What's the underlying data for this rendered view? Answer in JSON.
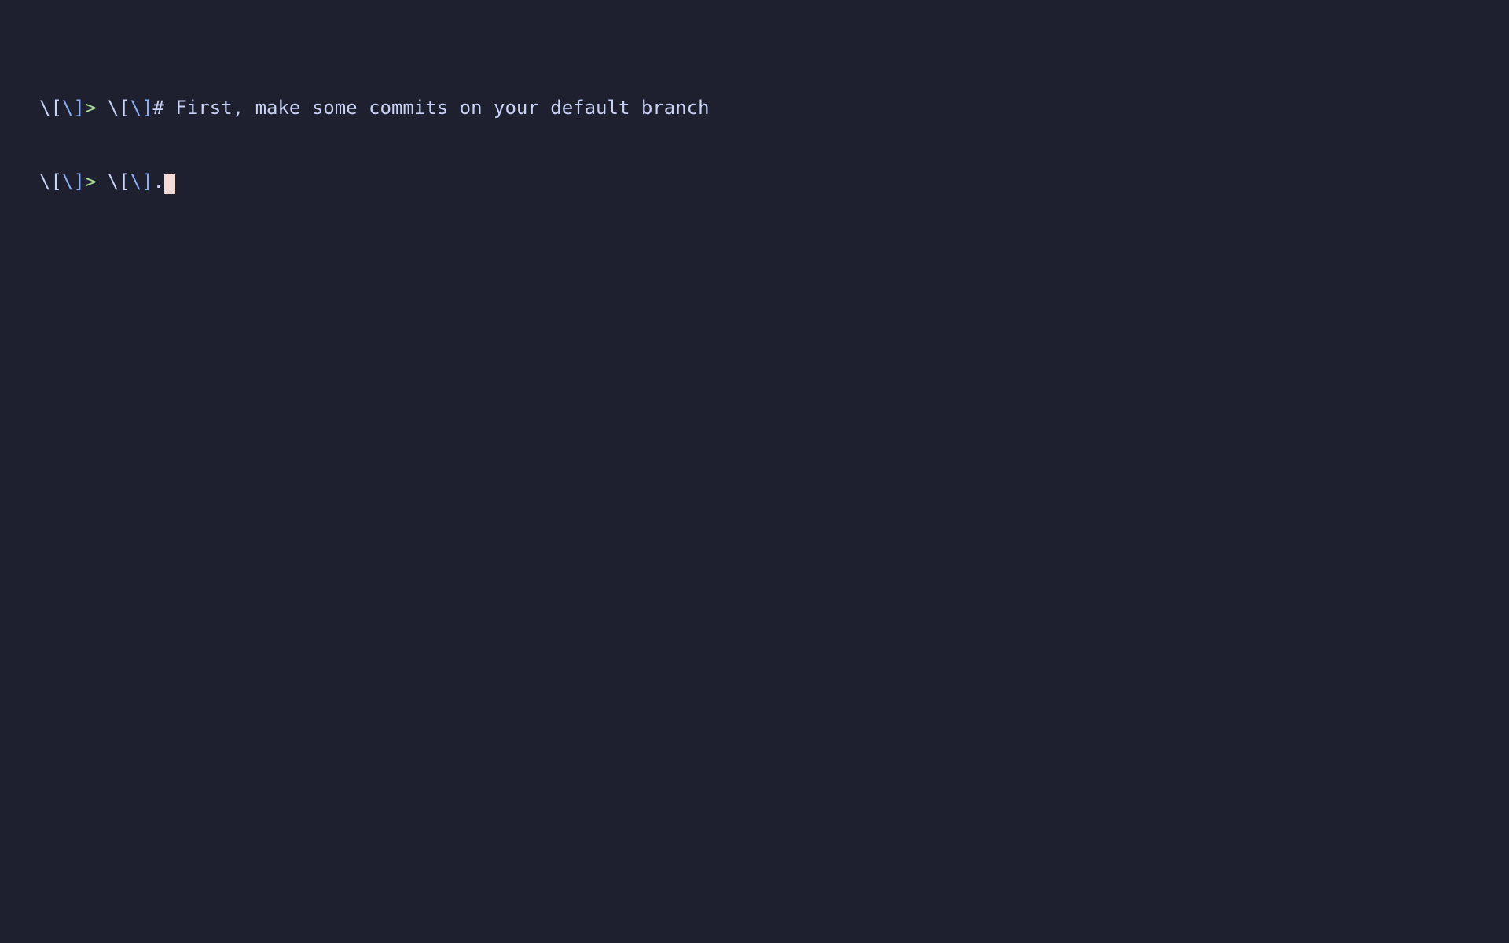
{
  "terminal": {
    "lines": [
      {
        "prompt_part1": "\\[",
        "prompt_part2": "\\]",
        "prompt_part3": "> ",
        "prompt_part4": "\\[",
        "prompt_part5": "\\]",
        "content": "# First, make some commits on your default branch"
      },
      {
        "prompt_part1": "\\[",
        "prompt_part2": "\\]",
        "prompt_part3": "> ",
        "prompt_part4": "\\[",
        "prompt_part5": "\\]",
        "content": "."
      }
    ]
  }
}
